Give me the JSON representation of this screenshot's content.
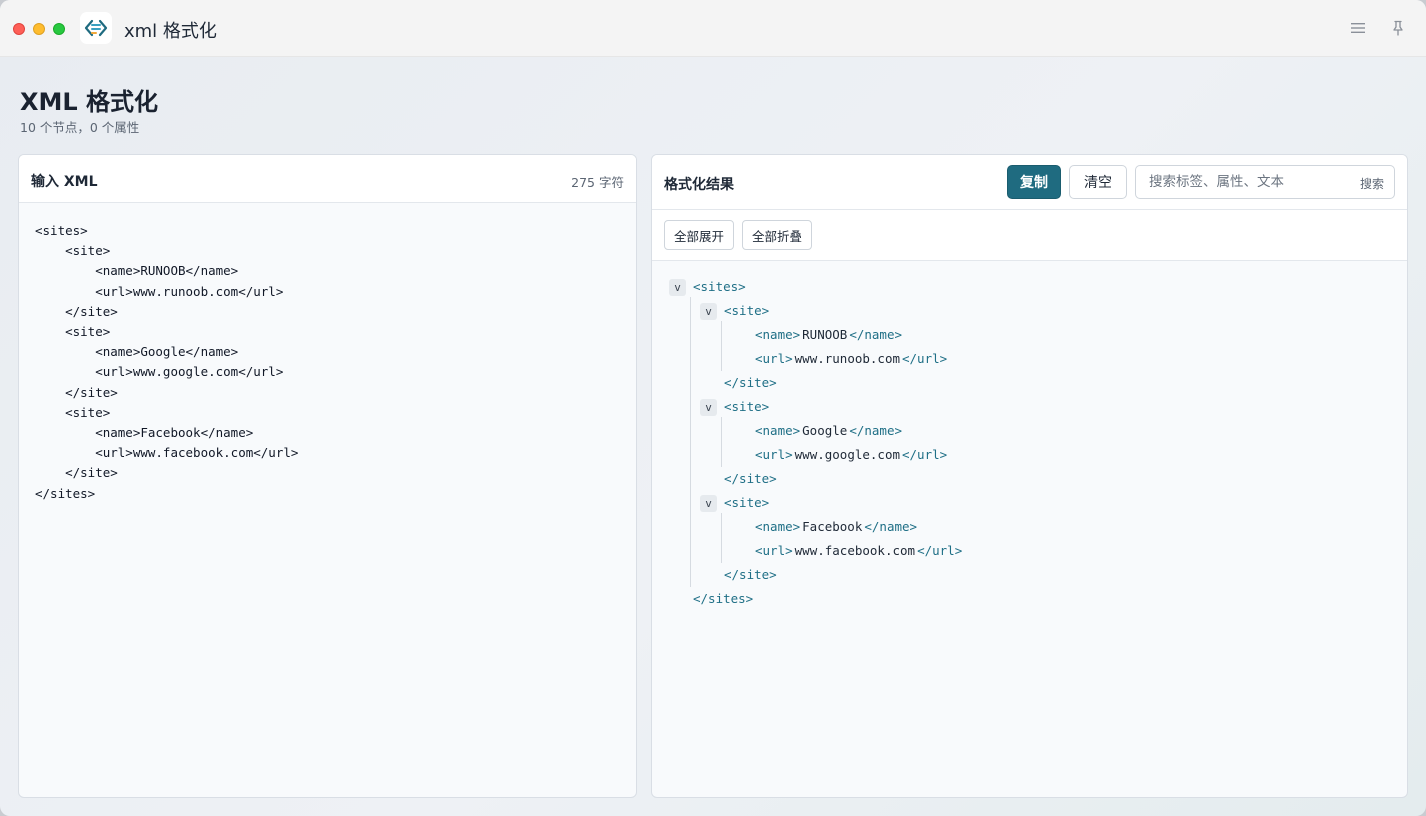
{
  "window": {
    "title": "xml 格式化",
    "icons": [
      "app-icon",
      "menu-icon",
      "pin-icon"
    ]
  },
  "page": {
    "title": "XML 格式化",
    "subtitle": "10 个节点，0 个属性"
  },
  "input_panel": {
    "heading": "输入 XML",
    "char_count": "275 字符",
    "lines": [
      "<sites>",
      "    <site>",
      "        <name>RUNOOB</name>",
      "        <url>www.runoob.com</url>",
      "    </site>",
      "    <site>",
      "        <name>Google</name>",
      "        <url>www.google.com</url>",
      "    </site>",
      "    <site>",
      "        <name>Facebook</name>",
      "        <url>www.facebook.com</url>",
      "    </site>",
      "</sites>"
    ]
  },
  "output_panel": {
    "heading": "格式化结果",
    "copy_label": "复制",
    "clear_label": "清空",
    "search_placeholder": "搜索标签、属性、文本",
    "search_label": "搜索",
    "expand_all_label": "全部展开",
    "collapse_all_label": "全部折叠",
    "toggle_glyph": "v",
    "tree": [
      {
        "depth": 0,
        "toggle": true,
        "open": "<sites>"
      },
      {
        "depth": 1,
        "toggle": true,
        "open": "<site>"
      },
      {
        "depth": 2,
        "open": "<name>",
        "text": "RUNOOB",
        "close": "</name>"
      },
      {
        "depth": 2,
        "open": "<url>",
        "text": "www.runoob.com",
        "close": "</url>"
      },
      {
        "depth": 1,
        "close": "</site>"
      },
      {
        "depth": 1,
        "toggle": true,
        "open": "<site>"
      },
      {
        "depth": 2,
        "open": "<name>",
        "text": "Google",
        "close": "</name>"
      },
      {
        "depth": 2,
        "open": "<url>",
        "text": "www.google.com",
        "close": "</url>"
      },
      {
        "depth": 1,
        "close": "</site>"
      },
      {
        "depth": 1,
        "toggle": true,
        "open": "<site>"
      },
      {
        "depth": 2,
        "open": "<name>",
        "text": "Facebook",
        "close": "</name>"
      },
      {
        "depth": 2,
        "open": "<url>",
        "text": "www.facebook.com",
        "close": "</url>"
      },
      {
        "depth": 1,
        "close": "</site>"
      },
      {
        "depth": 0,
        "close": "</sites>"
      }
    ]
  },
  "colors": {
    "accent": "#1f6b80",
    "tag": "#1f6f86"
  }
}
